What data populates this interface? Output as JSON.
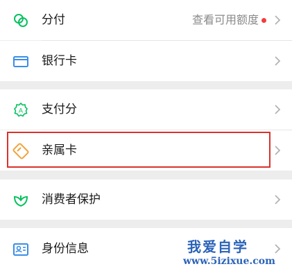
{
  "menu": {
    "items": [
      {
        "label": "分付",
        "hint": "查看可用额度",
        "icon": "fenfu-icon"
      },
      {
        "label": "银行卡",
        "icon": "bank-card-icon"
      },
      {
        "label": "支付分",
        "icon": "pay-score-icon"
      },
      {
        "label": "亲属卡",
        "icon": "family-card-icon"
      },
      {
        "label": "消费者保护",
        "icon": "consumer-protection-icon"
      },
      {
        "label": "身份信息",
        "icon": "id-info-icon"
      }
    ]
  },
  "watermark": {
    "title": "我爱自学",
    "url": "www.5izixue.com"
  },
  "colors": {
    "accent_green": "#07c160",
    "bank_blue": "#3a8ee6",
    "family_orange": "#f0a33a",
    "dot_red": "#f23d3d",
    "highlight_red": "#d9312b"
  }
}
